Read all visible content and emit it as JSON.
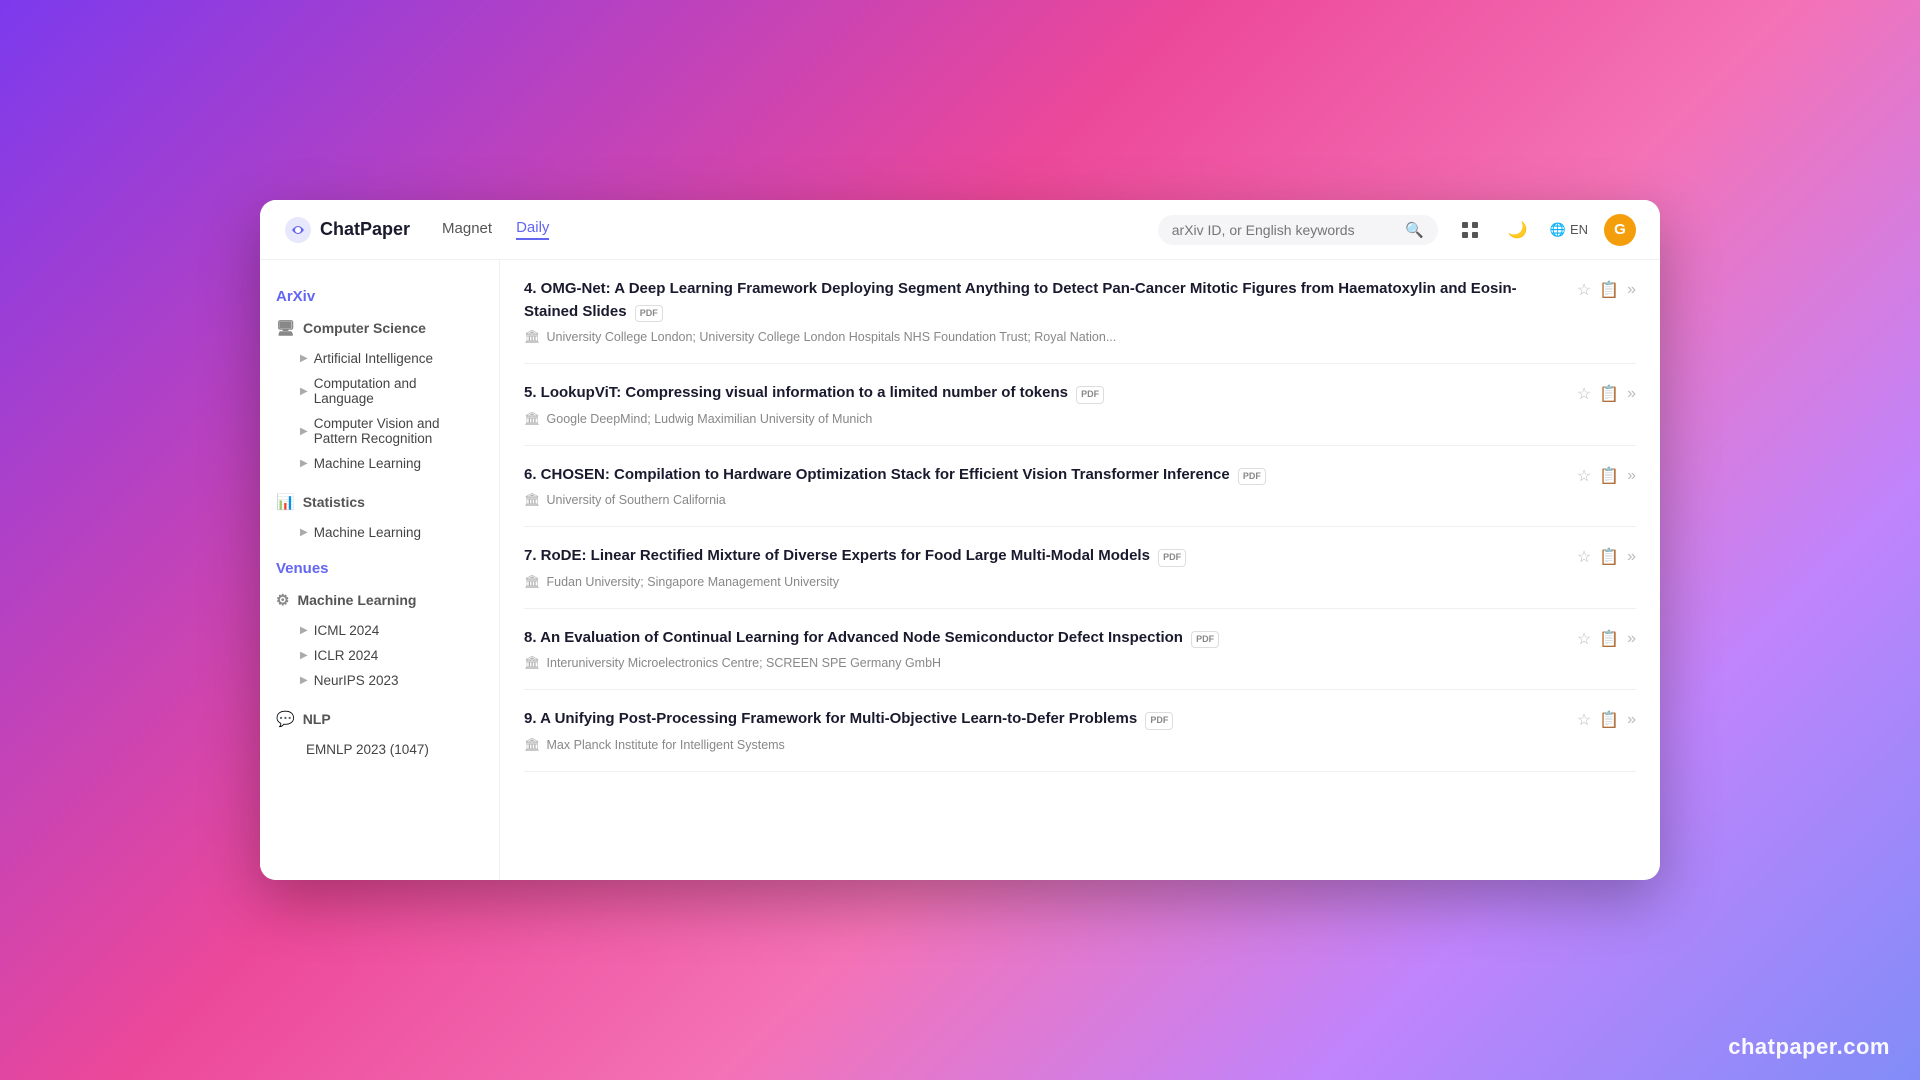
{
  "app": {
    "name": "ChatPaper",
    "watermark": "chatpaper.com"
  },
  "header": {
    "nav": [
      {
        "label": "Magnet",
        "active": false
      },
      {
        "label": "Daily",
        "active": true
      }
    ],
    "search_placeholder": "arXiv ID, or English keywords",
    "avatar_letter": "G",
    "lang": "EN"
  },
  "sidebar": {
    "sections": [
      {
        "title": "ArXiv",
        "categories": [
          {
            "label": "Computer Science",
            "icon": "🖥",
            "items": [
              "Artificial Intelligence",
              "Computation and Language",
              "Computer Vision and Pattern Recognition",
              "Machine Learning"
            ]
          },
          {
            "label": "Statistics",
            "icon": "📊",
            "items": [
              "Machine Learning"
            ]
          }
        ]
      },
      {
        "title": "Venues",
        "categories": [
          {
            "label": "Machine Learning",
            "icon": "⚙",
            "items": [
              "ICML 2024",
              "ICLR 2024",
              "NeurIPS 2023"
            ]
          },
          {
            "label": "NLP",
            "icon": "💬",
            "items": [
              "EMNLP 2023 (1047)"
            ]
          }
        ]
      }
    ]
  },
  "papers": [
    {
      "number": "4",
      "title": "OMG-Net: A Deep Learning Framework Deploying Segment Anything to Detect Pan-Cancer Mitotic Figures from Haematoxylin and Eosin-Stained Slides",
      "has_pdf": true,
      "institution": "University College London; University College London Hospitals NHS Foundation Trust; Royal Nation..."
    },
    {
      "number": "5",
      "title": "LookupViT: Compressing visual information to a limited number of tokens",
      "has_pdf": true,
      "institution": "Google DeepMind; Ludwig Maximilian University of Munich"
    },
    {
      "number": "6",
      "title": "CHOSEN: Compilation to Hardware Optimization Stack for Efficient Vision Transformer Inference",
      "has_pdf": true,
      "institution": "University of Southern California"
    },
    {
      "number": "7",
      "title": "RoDE: Linear Rectified Mixture of Diverse Experts for Food Large Multi-Modal Models",
      "has_pdf": true,
      "institution": "Fudan University; Singapore Management University"
    },
    {
      "number": "8",
      "title": "An Evaluation of Continual Learning for Advanced Node Semiconductor Defect Inspection",
      "has_pdf": true,
      "institution": "Interuniversity Microelectronics Centre; SCREEN SPE Germany GmbH"
    },
    {
      "number": "9",
      "title": "A Unifying Post-Processing Framework for Multi-Objective Learn-to-Defer Problems",
      "has_pdf": true,
      "institution": "Max Planck Institute for Intelligent Systems"
    }
  ]
}
